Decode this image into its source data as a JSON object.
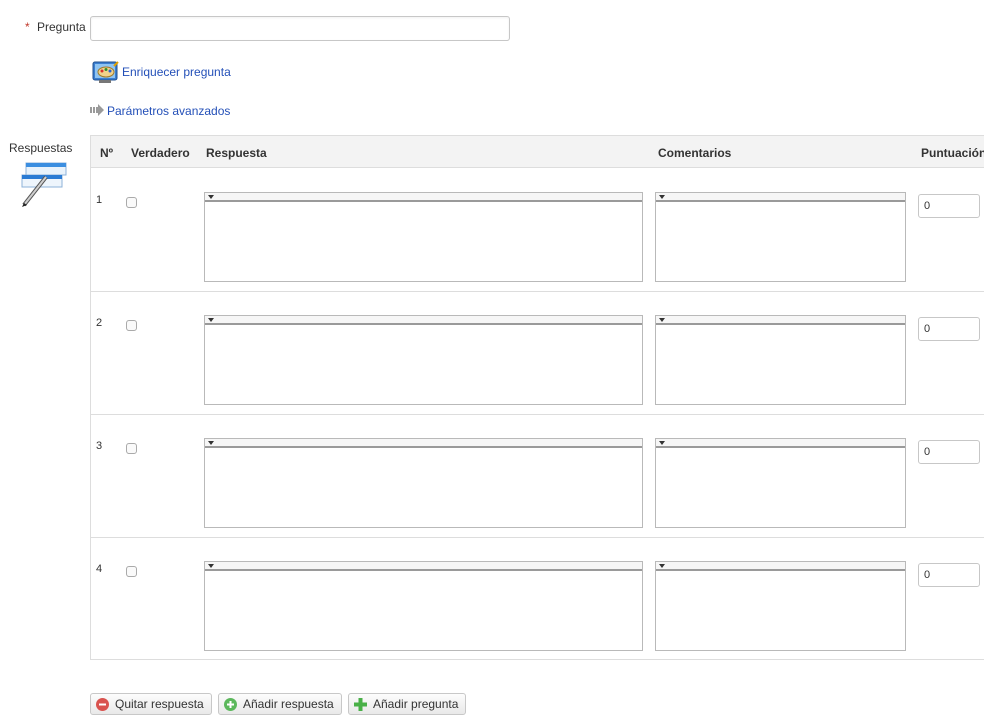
{
  "question": {
    "required_marker": "*",
    "label": "Pregunta",
    "value": "",
    "enrich_link": "Enriquecer pregunta",
    "advanced_link": "Parámetros avanzados"
  },
  "answers": {
    "label": "Respuestas",
    "columns": {
      "num": "Nº",
      "true": "Verdadero",
      "answer": "Respuesta",
      "comments": "Comentarios",
      "score": "Puntuación"
    },
    "rows": [
      {
        "num": "1",
        "checked": false,
        "score": "0"
      },
      {
        "num": "2",
        "checked": false,
        "score": "0"
      },
      {
        "num": "3",
        "checked": false,
        "score": "0"
      },
      {
        "num": "4",
        "checked": false,
        "score": "0"
      }
    ]
  },
  "buttons": {
    "remove_answer": "Quitar respuesta",
    "add_answer": "Añadir respuesta",
    "add_question": "Añadir pregunta"
  },
  "colors": {
    "link": "#2450b8",
    "remove": "#d9534f",
    "add_answer": "#5cb85c",
    "add_question": "#49b047",
    "required": "#c0392b"
  },
  "icons": {
    "enrich": "paint-palette-icon",
    "advanced": "arrow-right-icon",
    "answers": "editor-pen-icon",
    "remove": "minus-circle-icon",
    "add_answer": "plus-circle-icon",
    "add_question": "plus-icon"
  }
}
